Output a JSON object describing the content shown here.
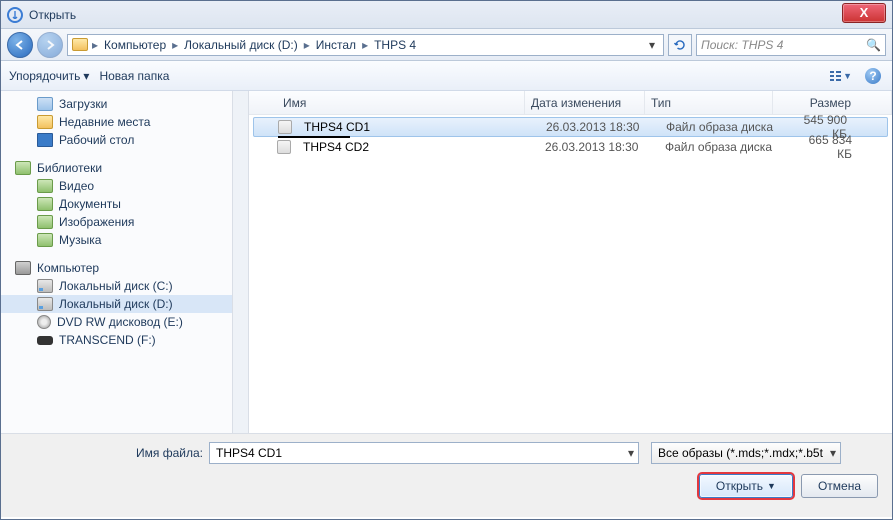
{
  "titlebar": {
    "title": "Открыть",
    "close": "X"
  },
  "nav": {
    "crumbs": [
      "Компьютер",
      "Локальный диск (D:)",
      "Инстал",
      "THPS 4"
    ],
    "search_placeholder": "Поиск: THPS 4"
  },
  "toolbar": {
    "organize": "Упорядочить",
    "new_folder": "Новая папка"
  },
  "sidebar": {
    "fav": [
      {
        "label": "Загрузки"
      },
      {
        "label": "Недавние места"
      },
      {
        "label": "Рабочий стол"
      }
    ],
    "lib_head": "Библиотеки",
    "lib": [
      {
        "label": "Видео"
      },
      {
        "label": "Документы"
      },
      {
        "label": "Изображения"
      },
      {
        "label": "Музыка"
      }
    ],
    "comp_head": "Компьютер",
    "comp": [
      {
        "label": "Локальный диск (C:)"
      },
      {
        "label": "Локальный диск (D:)"
      },
      {
        "label": "DVD RW дисковод (E:)"
      },
      {
        "label": "TRANSCEND (F:)"
      }
    ]
  },
  "columns": {
    "name": "Имя",
    "date": "Дата изменения",
    "type": "Тип",
    "size": "Размер"
  },
  "files": [
    {
      "name": "THPS4 CD1",
      "date": "26.03.2013 18:30",
      "type": "Файл образа диска",
      "size": "545 900 КБ",
      "selected": true
    },
    {
      "name": "THPS4 CD2",
      "date": "26.03.2013 18:30",
      "type": "Файл образа диска",
      "size": "665 834 КБ",
      "selected": false
    }
  ],
  "footer": {
    "filename_label": "Имя файла:",
    "filename_value": "THPS4 CD1",
    "filter": "Все образы (*.mds;*.mdx;*.b5t",
    "open": "Открыть",
    "cancel": "Отмена"
  }
}
